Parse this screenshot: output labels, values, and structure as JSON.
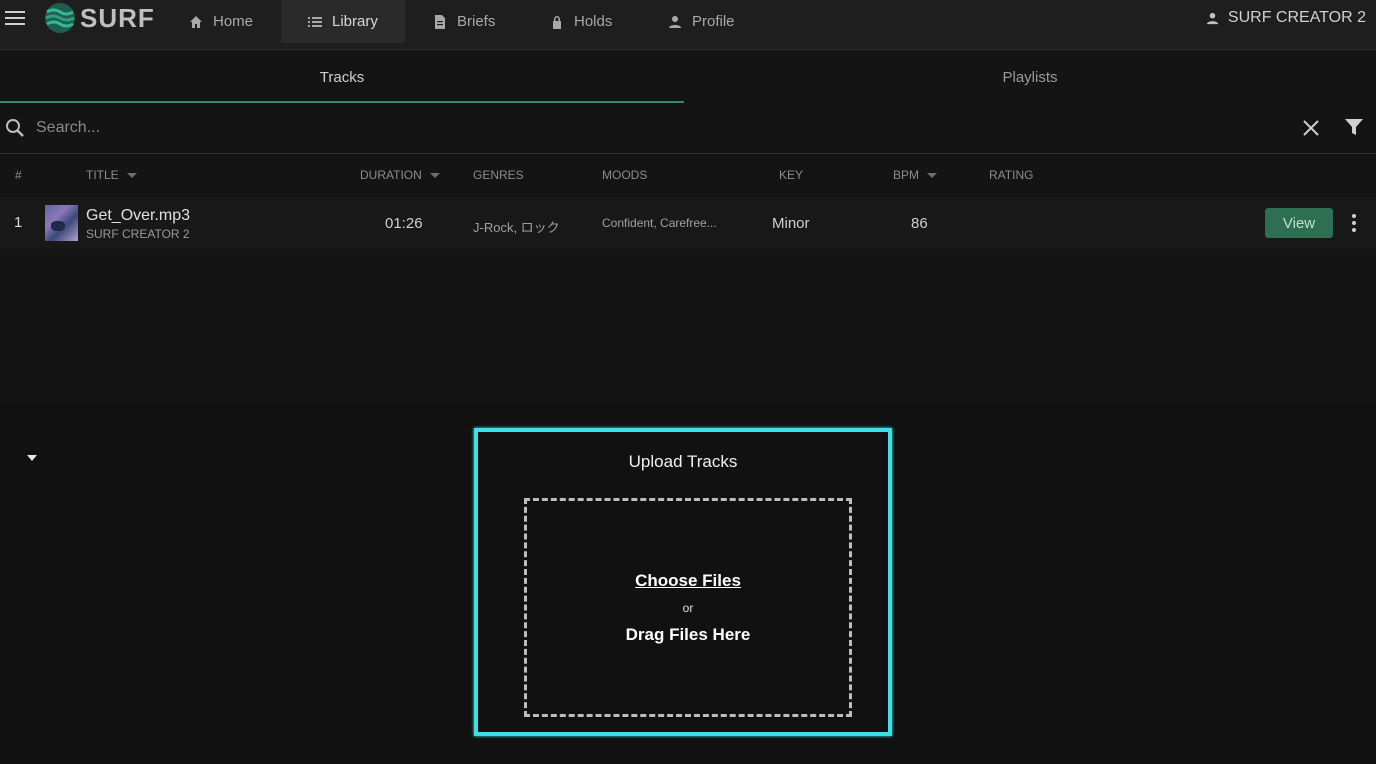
{
  "app": {
    "logo_text": "SURF",
    "brand_color": "#2fa88a"
  },
  "nav": {
    "items": [
      {
        "label": "Home",
        "icon": "home-icon"
      },
      {
        "label": "Library",
        "icon": "list-icon",
        "active": true
      },
      {
        "label": "Briefs",
        "icon": "document-icon"
      },
      {
        "label": "Holds",
        "icon": "lock-icon"
      },
      {
        "label": "Profile",
        "icon": "person-icon"
      }
    ],
    "user": "SURF CREATOR 2"
  },
  "tabs": [
    {
      "label": "Tracks",
      "active": true
    },
    {
      "label": "Playlists",
      "active": false
    }
  ],
  "search": {
    "placeholder": "Search...",
    "value": ""
  },
  "table": {
    "columns": [
      "#",
      "TITLE",
      "DURATION",
      "GENRES",
      "MOODS",
      "KEY",
      "BPM",
      "RATING"
    ],
    "rows": [
      {
        "index": "1",
        "title": "Get_Over.mp3",
        "artist": "SURF CREATOR 2",
        "duration": "01:26",
        "genres": "J-Rock, ロック",
        "moods": "Confident, Carefree...",
        "key": "Minor",
        "bpm": "86",
        "rating": "",
        "action_label": "View"
      }
    ]
  },
  "upload": {
    "title": "Upload Tracks",
    "choose_label": "Choose Files",
    "or_label": "or",
    "drag_label": "Drag Files Here",
    "highlight_color": "#3de0e6"
  }
}
